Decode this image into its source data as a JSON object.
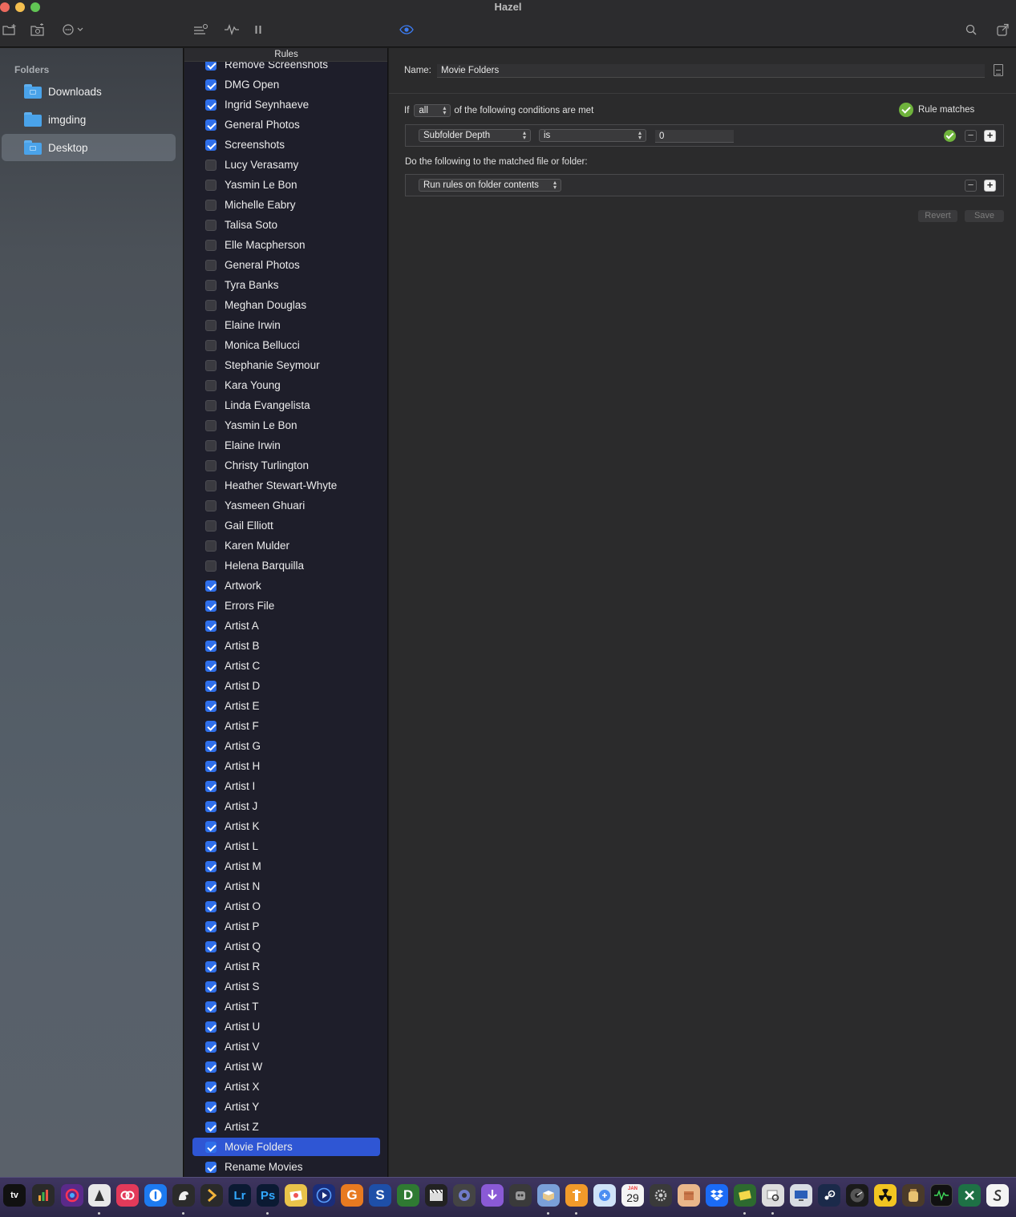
{
  "window": {
    "title": "Hazel"
  },
  "toolbar": {
    "icons": [
      "new-folder-icon",
      "folder-options-icon",
      "more-icon",
      "rules-list-icon",
      "activity-icon",
      "pause-icon",
      "preview-eye-icon",
      "search-icon",
      "detach-icon"
    ]
  },
  "sidebar": {
    "heading": "Folders",
    "items": [
      {
        "label": "Downloads",
        "selected": false
      },
      {
        "label": "imgding",
        "selected": false
      },
      {
        "label": "Desktop",
        "selected": true
      }
    ]
  },
  "rules": {
    "header": "Rules",
    "items": [
      {
        "label": "Remove Screenshots",
        "checked": true
      },
      {
        "label": "DMG Open",
        "checked": true
      },
      {
        "label": "Ingrid Seynhaeve",
        "checked": true
      },
      {
        "label": "General Photos",
        "checked": true
      },
      {
        "label": "Screenshots",
        "checked": true
      },
      {
        "label": "Lucy Verasamy",
        "checked": false
      },
      {
        "label": "Yasmin Le Bon",
        "checked": false
      },
      {
        "label": "Michelle Eabry",
        "checked": false
      },
      {
        "label": "Talisa Soto",
        "checked": false
      },
      {
        "label": "Elle Macpherson",
        "checked": false
      },
      {
        "label": "General Photos",
        "checked": false
      },
      {
        "label": "Tyra Banks",
        "checked": false
      },
      {
        "label": "Meghan Douglas",
        "checked": false
      },
      {
        "label": "Elaine Irwin",
        "checked": false
      },
      {
        "label": "Monica Bellucci",
        "checked": false
      },
      {
        "label": "Stephanie Seymour",
        "checked": false
      },
      {
        "label": "Kara Young",
        "checked": false
      },
      {
        "label": "Linda Evangelista",
        "checked": false
      },
      {
        "label": "Yasmin Le Bon",
        "checked": false
      },
      {
        "label": "Elaine Irwin",
        "checked": false
      },
      {
        "label": "Christy Turlington",
        "checked": false
      },
      {
        "label": "Heather Stewart-Whyte",
        "checked": false
      },
      {
        "label": "Yasmeen Ghuari",
        "checked": false
      },
      {
        "label": "Gail Elliott",
        "checked": false
      },
      {
        "label": "Karen Mulder",
        "checked": false
      },
      {
        "label": "Helena Barquilla",
        "checked": false
      },
      {
        "label": "Artwork",
        "checked": true
      },
      {
        "label": "Errors File",
        "checked": true
      },
      {
        "label": "Artist A",
        "checked": true
      },
      {
        "label": "Artist B",
        "checked": true
      },
      {
        "label": "Artist C",
        "checked": true
      },
      {
        "label": "Artist D",
        "checked": true
      },
      {
        "label": "Artist E",
        "checked": true
      },
      {
        "label": "Artist F",
        "checked": true
      },
      {
        "label": "Artist G",
        "checked": true
      },
      {
        "label": "Artist H",
        "checked": true
      },
      {
        "label": "Artist I",
        "checked": true
      },
      {
        "label": "Artist J",
        "checked": true
      },
      {
        "label": "Artist K",
        "checked": true
      },
      {
        "label": "Artist L",
        "checked": true
      },
      {
        "label": "Artist M",
        "checked": true
      },
      {
        "label": "Artist N",
        "checked": true
      },
      {
        "label": "Artist O",
        "checked": true
      },
      {
        "label": "Artist P",
        "checked": true
      },
      {
        "label": "Artist Q",
        "checked": true
      },
      {
        "label": "Artist R",
        "checked": true
      },
      {
        "label": "Artist S",
        "checked": true
      },
      {
        "label": "Artist T",
        "checked": true
      },
      {
        "label": "Artist U",
        "checked": true
      },
      {
        "label": "Artist V",
        "checked": true
      },
      {
        "label": "Artist W",
        "checked": true
      },
      {
        "label": "Artist X",
        "checked": true
      },
      {
        "label": "Artist Y",
        "checked": true
      },
      {
        "label": "Artist Z",
        "checked": true
      },
      {
        "label": "Movie Folders",
        "checked": true,
        "selected": true
      },
      {
        "label": "Rename Movies",
        "checked": true
      }
    ]
  },
  "editor": {
    "name_label": "Name:",
    "name_value": "Movie Folders",
    "if_label": "If",
    "match_mode": "all",
    "conditions_suffix": "of the following conditions are met",
    "rule_status": "Rule matches",
    "condition": {
      "attribute": "Subfolder Depth",
      "operator": "is",
      "value": "0"
    },
    "actions_label": "Do the following to the matched file or folder:",
    "action": {
      "type": "Run rules on folder contents"
    },
    "revert_label": "Revert",
    "save_label": "Save"
  },
  "dock": {
    "calendar_month": "JAN",
    "calendar_day": "29",
    "text_icons": [
      "tv",
      "Lr",
      "Ps",
      "G",
      "S",
      "D"
    ]
  },
  "colors": {
    "accent": "#2f6fea",
    "selection": "#2f56d4",
    "success": "#6fb33c",
    "folder": "#4aa3ea"
  }
}
